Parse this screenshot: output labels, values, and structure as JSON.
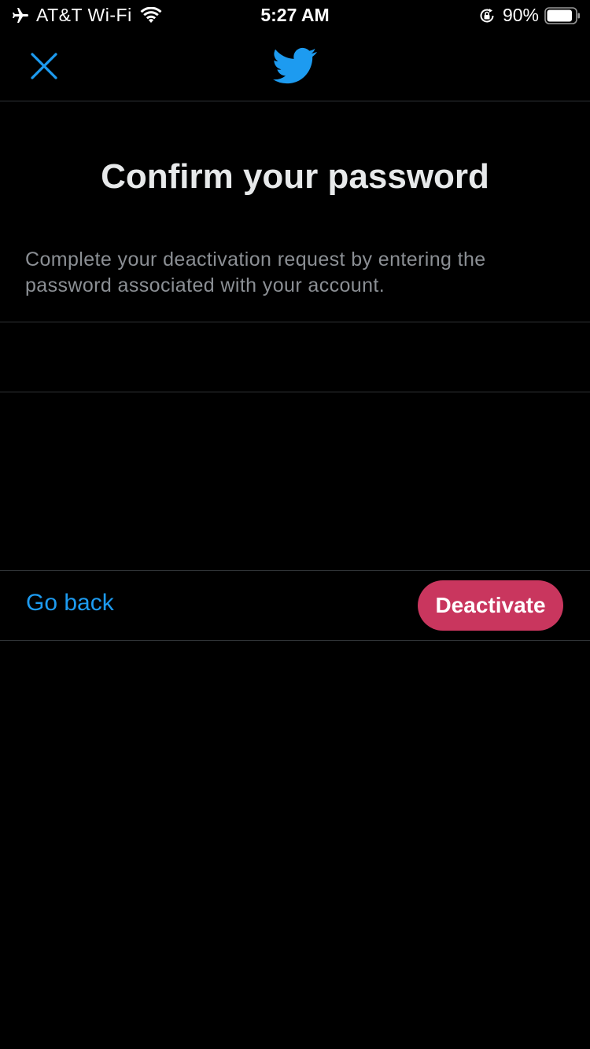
{
  "status_bar": {
    "carrier": "AT&T Wi-Fi",
    "time": "5:27 AM",
    "battery_percent": "90%",
    "battery_level": 0.9,
    "icons": [
      "airplane-icon",
      "wifi-icon",
      "orientation-lock-icon",
      "battery-icon"
    ]
  },
  "nav": {
    "close_icon": "close-icon",
    "logo_icon": "twitter-bird-icon"
  },
  "content": {
    "title": "Confirm your password",
    "description": "Complete your deactivation request by entering the password associated with your account.",
    "password_field": {
      "value": "",
      "placeholder": ""
    }
  },
  "actions": {
    "go_back_label": "Go back",
    "deactivate_label": "Deactivate"
  },
  "colors": {
    "background": "#000000",
    "accent_blue": "#1d9bf0",
    "deactivate_red": "#c9365e",
    "divider": "#2f3336",
    "secondary_text": "#8b8f94"
  }
}
